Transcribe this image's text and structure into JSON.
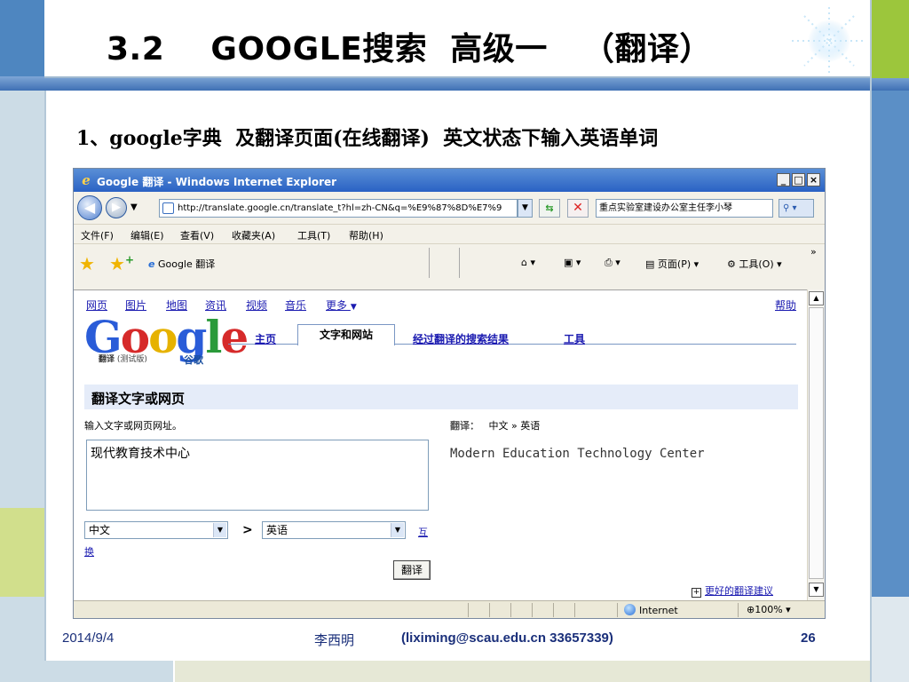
{
  "slide": {
    "title": "3.2    GOOGLE搜索  高级一   （翻译）",
    "subtitle": "1、google字典  及翻译页面(在线翻译)  英文状态下输入英语单词"
  },
  "browser": {
    "window_title": "Google 翻译 - Windows Internet Explorer",
    "address": "http://translate.google.cn/translate_t?hl=zh-CN&q=%E9%87%8D%E7%9",
    "search_box": "重点实验室建设办公室主任李小琴",
    "menus": [
      "文件(F)",
      "编辑(E)",
      "查看(V)",
      "收藏夹(A)",
      "工具(T)",
      "帮助(H)"
    ],
    "tab_label": "Google 翻译",
    "command_page": "页面(P)",
    "command_tools": "工具(O)",
    "status_zone": "Internet",
    "zoom": "100%"
  },
  "google": {
    "top_links": [
      "网页",
      "图片",
      "地图",
      "资讯",
      "视频",
      "音乐",
      "更多"
    ],
    "more_arrow": "▼",
    "help": "帮助",
    "logo_text": "Google",
    "logo_sub": "翻译",
    "logo_sub_note": "(测试版)",
    "logo_guge": "谷歌",
    "tabs": {
      "home": "主页",
      "text_web": "文字和网站",
      "translated_search": "经过翻译的搜索结果",
      "tools": "工具"
    },
    "section_title": "翻译文字或网页",
    "input_label": "输入文字或网页网址。",
    "source_text": "现代教育技术中心",
    "source_lang": "中文",
    "target_lang": "英语",
    "arrow": ">",
    "swap_1": "互",
    "swap_2": "换",
    "translate_button": "翻译",
    "direction_prefix": "翻译：",
    "direction_from": "中文",
    "direction_sep": "»",
    "direction_to": "英语",
    "result": "Modern Education Technology Center",
    "better_suggestion": "更好的翻译建议"
  },
  "footer": {
    "date": "2014/9/4",
    "author": "李西明",
    "contact": "(liximing@scau.edu.cn  33657339)",
    "page": "26"
  },
  "colors": {
    "title_blue_band": "#3f70b4",
    "right_green": "#9cc63c",
    "link_blue": "#1a1ab0",
    "section_bar": "#e5ecf9",
    "footer_text": "#1a2f7a"
  }
}
